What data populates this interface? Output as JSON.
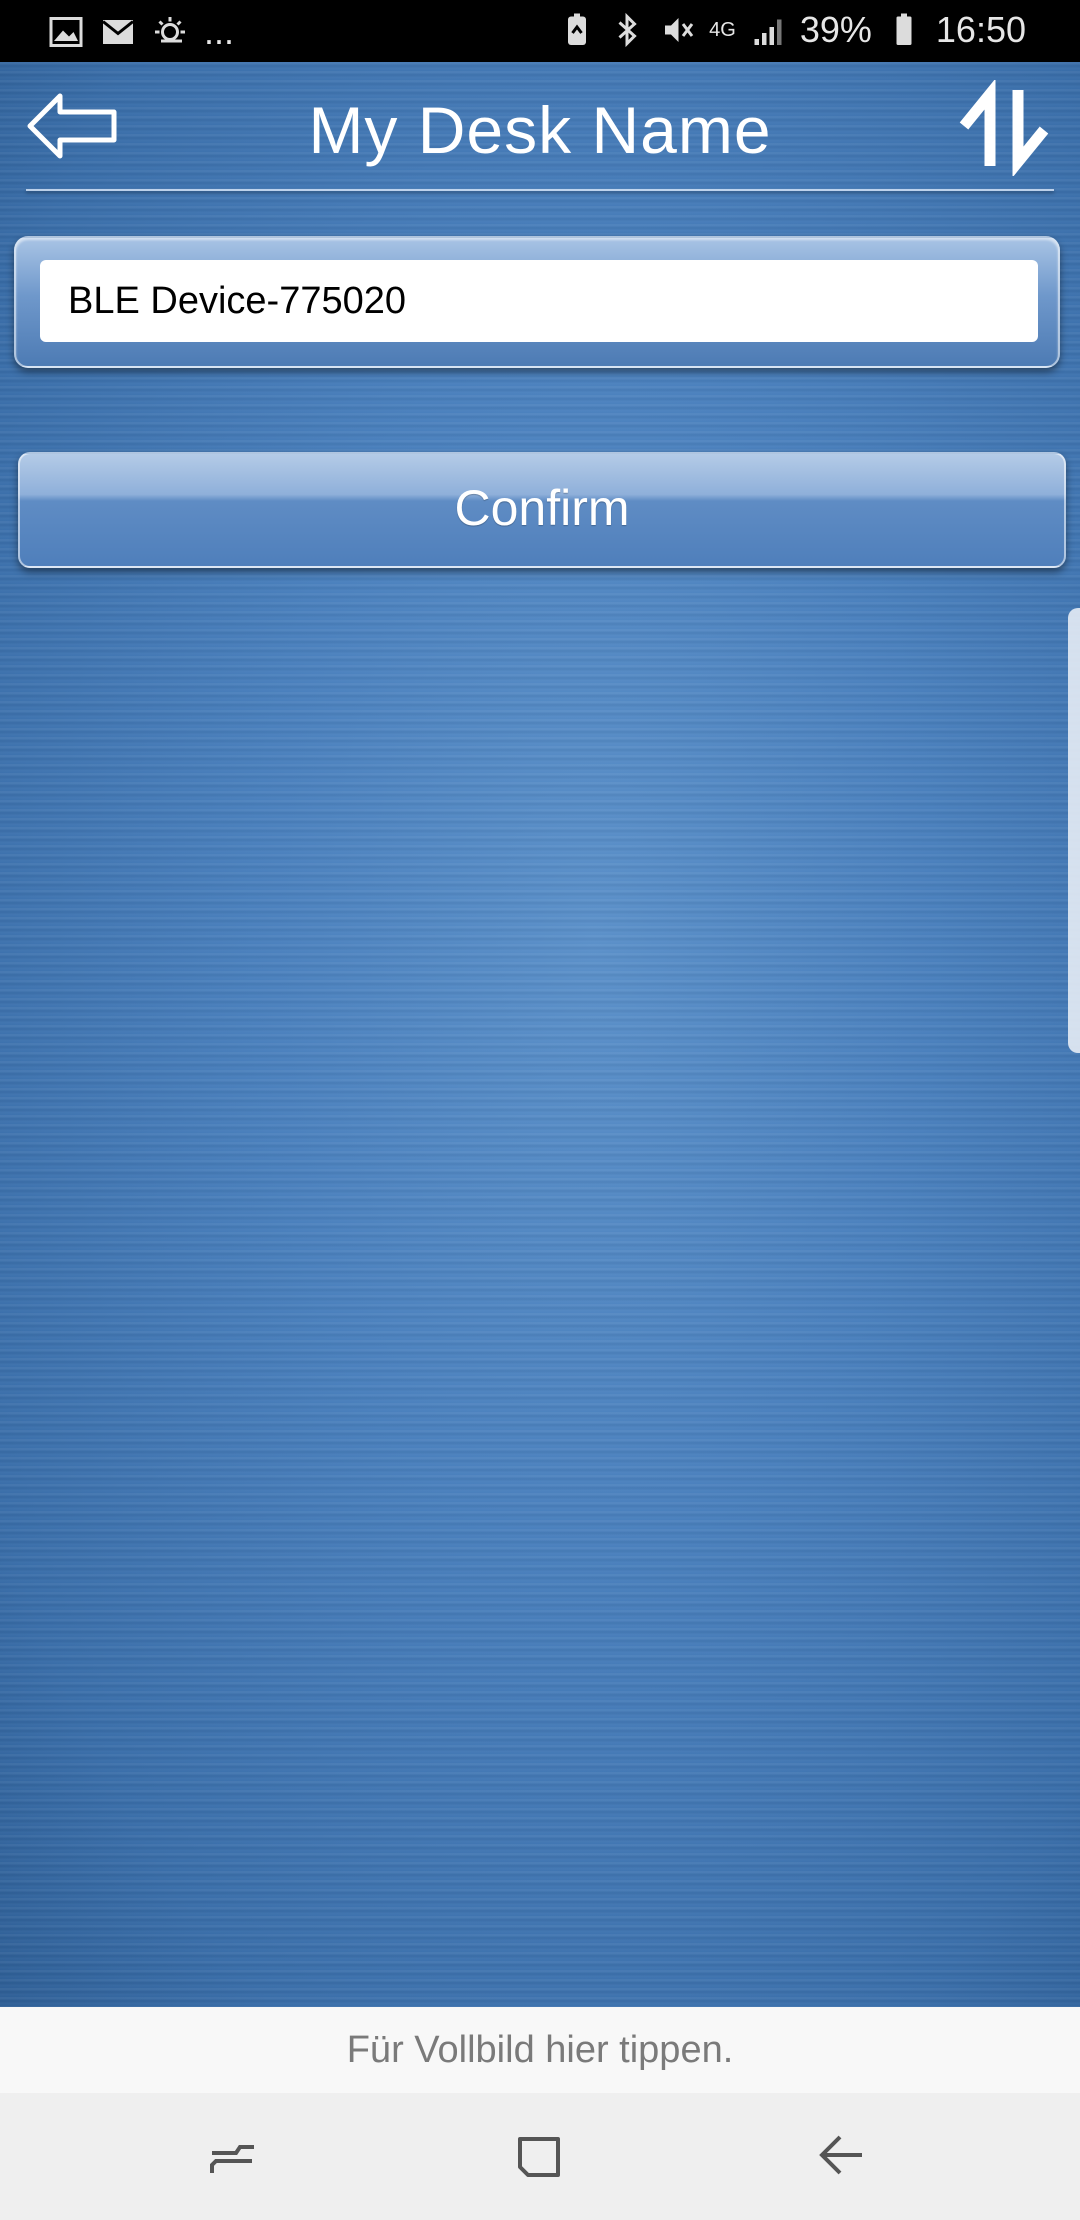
{
  "status_bar": {
    "notifications_more": "...",
    "network": "4G",
    "battery": "39%",
    "time": "16:50"
  },
  "header": {
    "title": "My Desk Name"
  },
  "form": {
    "device_name_value": "BLE Device-775020",
    "confirm_label": "Confirm"
  },
  "system": {
    "fullscreen_hint": "Für Vollbild hier tippen."
  },
  "colors": {
    "background": "#4a80bd",
    "panel": "#6f98cb",
    "text": "#ffffff"
  }
}
